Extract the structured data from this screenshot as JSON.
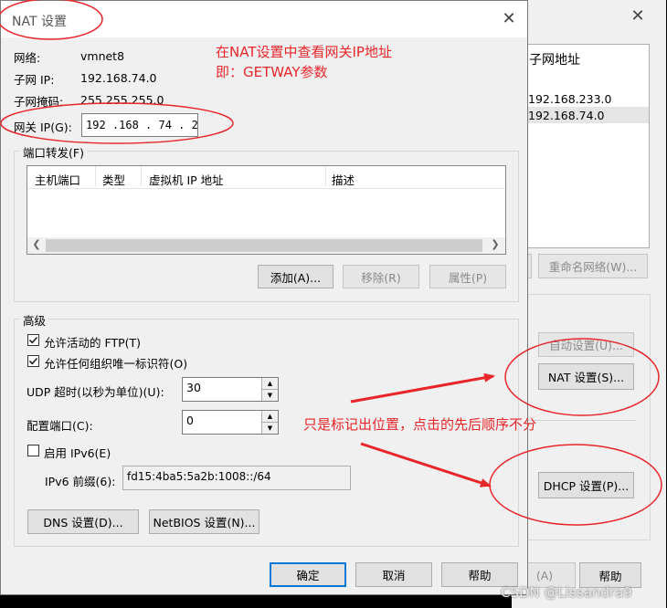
{
  "nat_dialog": {
    "title": "NAT 设置",
    "network_label": "网络:",
    "network_value": "vmnet8",
    "subnet_ip_label": "子网 IP:",
    "subnet_ip_value": "192.168.74.0",
    "subnet_mask_label": "子网掩码:",
    "subnet_mask_value": "255.255.255.0",
    "gateway_label": "网关 IP(G):",
    "gateway_value": "192 .168 . 74  .  2",
    "port_forward_title": "端口转发(F)",
    "columns": [
      "主机端口",
      "类型",
      "虚拟机 IP 地址",
      "描述"
    ],
    "add_button": "添加(A)...",
    "remove_button": "移除(R)",
    "properties_button": "属性(P)",
    "advanced_title": "高级",
    "allow_ftp_label": "允许活动的 FTP(T)",
    "allow_ftp_checked": true,
    "allow_oui_label": "允许任何组织唯一标识符(O)",
    "allow_oui_checked": true,
    "udp_timeout_label": "UDP 超时(以秒为单位)(U):",
    "udp_timeout_value": "30",
    "config_port_label": "配置端口(C):",
    "config_port_value": "0",
    "enable_ipv6_label": "启用 IPv6(E)",
    "enable_ipv6_checked": false,
    "ipv6_prefix_label": "IPv6 前缀(6):",
    "ipv6_prefix_value": "fd15:4ba5:5a2b:1008::/64",
    "dns_button": "DNS 设置(D)...",
    "netbios_button": "NetBIOS 设置(N)...",
    "ok_button": "确定",
    "cancel_button": "取消",
    "help_button": "帮助"
  },
  "back_window": {
    "subnet_header": "子网地址",
    "subnet_rows": [
      "192.168.233.0",
      "192.168.74.0"
    ],
    "rename_button": "重命名网络(W)...",
    "auto_button": "自动设置(U)...",
    "nat_button": "NAT 设置(S)...",
    "dhcp_button": "DHCP 设置(P)...",
    "apply_button": "(A)",
    "help_button": "帮助"
  },
  "annotations": {
    "note1_line1": "在NAT设置中查看网关IP地址",
    "note1_line2": "即：GETWAY参数",
    "note2": "只是标记出位置，点击的先后顺序不分",
    "color": "#e8262a"
  },
  "watermark": "CSDN @Lissandra9"
}
